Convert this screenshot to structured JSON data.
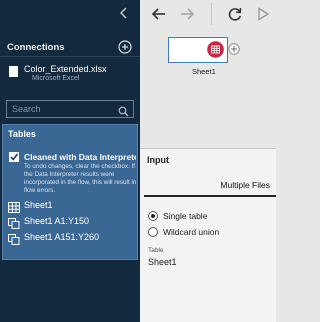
{
  "sidebar": {
    "collapse_icon": "chevron-left-icon",
    "connections_title": "Connections",
    "add_connection_icon": "plus-circle-icon",
    "connection": {
      "file_name": "Color_Extended.xlsx",
      "file_type": "Microsoft Excel"
    },
    "search": {
      "placeholder": "Search"
    },
    "tables": {
      "title": "Tables",
      "interpreter": {
        "checked": true,
        "label": "Cleaned with Data Interpreter",
        "note": "To undo changes, clear the checkbox. If the Data Interpreter results were incorporated in the flow, this will result in flow errors."
      },
      "items": [
        {
          "icon": "table-icon",
          "label": "Sheet1"
        },
        {
          "icon": "named-range-icon",
          "label": "Sheet1 A1:Y150"
        },
        {
          "icon": "named-range-icon",
          "label": "Sheet1 A151:Y260"
        }
      ]
    }
  },
  "toolbar": {
    "buttons": [
      "undo-icon",
      "redo-icon",
      "refresh-icon",
      "run-icon"
    ]
  },
  "canvas": {
    "node": {
      "label": "Sheet1",
      "icon": "input-table-icon",
      "add_icon": "plus-circle-icon"
    }
  },
  "panel": {
    "title": "Input",
    "tab": "Multiple Files",
    "options": [
      {
        "label": "Single table",
        "selected": true
      },
      {
        "label": "Wildcard union",
        "selected": false
      }
    ],
    "table_field_label": "Table",
    "table_field_value": "Sheet1"
  },
  "colors": {
    "sidebar_bg": "#13293d",
    "tables_bg": "#3b6795",
    "node_accent": "#c0294a",
    "node_border": "#3e7cc0"
  }
}
